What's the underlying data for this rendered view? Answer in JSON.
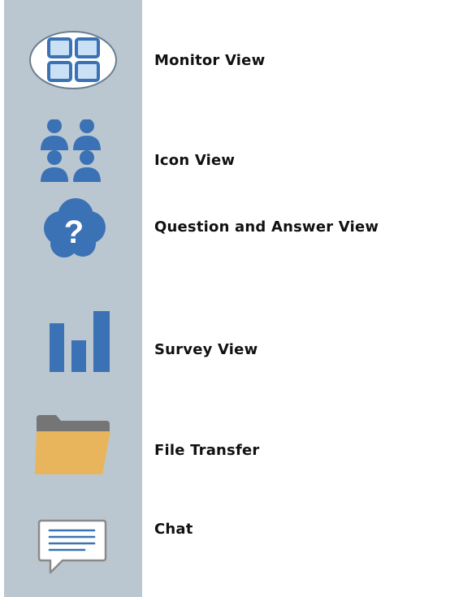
{
  "colors": {
    "sidebar_bg": "#bac7d0",
    "icon_blue": "#3a72b5",
    "folder_front": "#e9b55c",
    "folder_back": "#757575"
  },
  "menu": {
    "items": [
      {
        "icon": "monitor-view-icon",
        "label": "Monitor View",
        "selected": true
      },
      {
        "icon": "users-grid-icon",
        "label": "Icon View",
        "selected": false
      },
      {
        "icon": "question-cloud-icon",
        "label": "Question and Answer View",
        "selected": false
      },
      {
        "icon": "bar-chart-icon",
        "label": "Survey View",
        "selected": false
      },
      {
        "icon": "folder-icon",
        "label": "File Transfer",
        "selected": false
      },
      {
        "icon": "chat-bubble-icon",
        "label": "Chat",
        "selected": false
      }
    ]
  }
}
